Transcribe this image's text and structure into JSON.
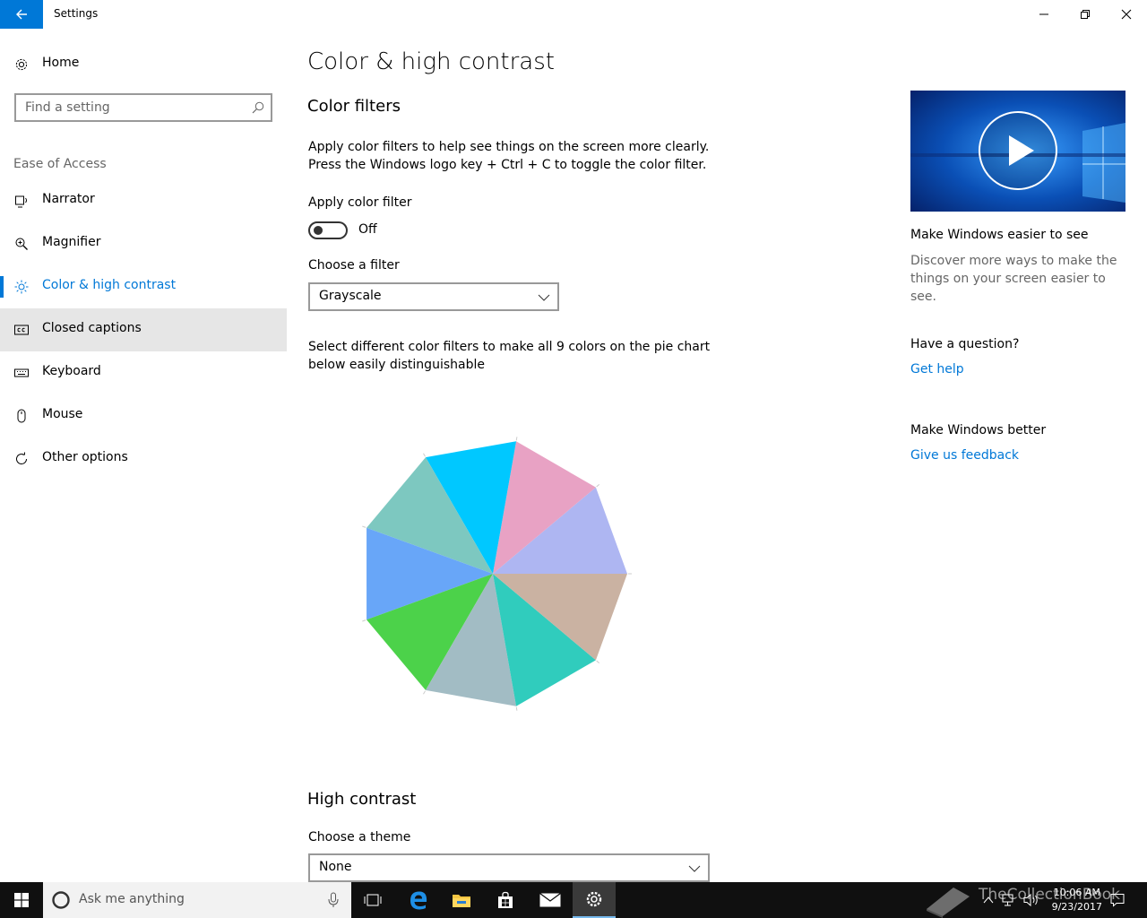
{
  "window": {
    "title": "Settings"
  },
  "nav": {
    "home": "Home",
    "search_placeholder": "Find a setting",
    "section": "Ease of Access",
    "items": [
      {
        "label": "Narrator",
        "icon": "narrator-icon"
      },
      {
        "label": "Magnifier",
        "icon": "magnifier-icon"
      },
      {
        "label": "Color & high contrast",
        "icon": "brightness-icon",
        "selected": true
      },
      {
        "label": "Closed captions",
        "icon": "cc-icon",
        "hover": true
      },
      {
        "label": "Keyboard",
        "icon": "keyboard-icon"
      },
      {
        "label": "Mouse",
        "icon": "mouse-icon"
      },
      {
        "label": "Other options",
        "icon": "refresh-icon"
      }
    ]
  },
  "main": {
    "title": "Color & high contrast",
    "color_filters": {
      "heading": "Color filters",
      "desc_line1": "Apply color filters to help see things on the screen more clearly.",
      "desc_line2": "Press the Windows logo key + Ctrl + C to toggle the color filter.",
      "apply_label": "Apply color filter",
      "toggle_state": "Off",
      "choose_label": "Choose a filter",
      "choose_value": "Grayscale",
      "pie_desc_line1": "Select different color filters to make all 9 colors on the pie chart",
      "pie_desc_line2": "below easily distinguishable",
      "pie_colors": [
        "#aeb6f2",
        "#e8a2c4",
        "#00c8ff",
        "#7dc8c0",
        "#68a6f8",
        "#4cd24a",
        "#a2bcc4",
        "#30ccbd",
        "#cab2a2"
      ]
    },
    "high_contrast": {
      "heading": "High contrast",
      "choose_label": "Choose a theme",
      "choose_value": "None"
    }
  },
  "right": {
    "video_title": "Make Windows easier to see",
    "video_desc_line1": "Discover more ways to make the",
    "video_desc_line2": "things on your screen easier to see.",
    "question": "Have a question?",
    "get_help": "Get help",
    "better": "Make Windows better",
    "feedback": "Give us feedback"
  },
  "taskbar": {
    "search_text": "Ask me anything",
    "time": "10:06 AM",
    "date": "9/23/2017",
    "watermark": "TheCollectionBook"
  }
}
